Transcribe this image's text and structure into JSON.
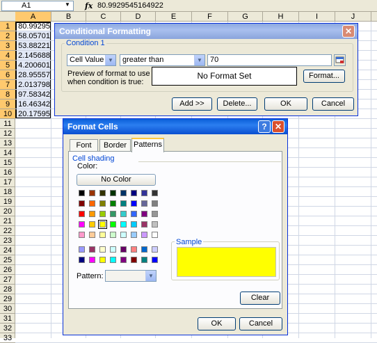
{
  "formula_bar": {
    "name_box": "A1",
    "fx_label": "fx",
    "value": "80.9929545164922"
  },
  "grid": {
    "columns": [
      "A",
      "B",
      "C",
      "D",
      "E",
      "F",
      "G",
      "H",
      "I",
      "J"
    ],
    "rows": [
      "1",
      "2",
      "3",
      "4",
      "5",
      "6",
      "7",
      "8",
      "9",
      "10",
      "11",
      "12",
      "13",
      "14",
      "15",
      "16",
      "17",
      "18",
      "19",
      "20",
      "21",
      "22",
      "23",
      "24",
      "25",
      "26",
      "27",
      "28",
      "29",
      "30",
      "31",
      "32",
      "33"
    ],
    "col_a_values": [
      "80.99295",
      "58.05701",
      "53.88221",
      "2.145688",
      "4.200601",
      "28.95557",
      "2.013798",
      "97.58342",
      "16.46342",
      "20.17595"
    ]
  },
  "conditional_formatting": {
    "title": "Conditional Formatting",
    "condition_label": "Condition 1",
    "type_value": "Cell Value Is",
    "operator_value": "greater than",
    "value": "70",
    "preview_label": "Preview of format to use when condition is true:",
    "preview_text": "No Format Set",
    "format_button": "Format...",
    "add_button": "Add >>",
    "delete_button": "Delete...",
    "ok_button": "OK",
    "cancel_button": "Cancel"
  },
  "format_cells": {
    "title": "Format Cells",
    "tabs": [
      "Font",
      "Border",
      "Patterns"
    ],
    "active_tab": "Patterns",
    "cell_shading_label": "Cell shading",
    "color_label": "Color:",
    "no_color_button": "No Color",
    "sample_label": "Sample",
    "sample_color": "#ffff00",
    "pattern_label": "Pattern:",
    "clear_button": "Clear",
    "ok_button": "OK",
    "cancel_button": "Cancel",
    "palette": [
      [
        "#000000",
        "#993300",
        "#333300",
        "#003300",
        "#003366",
        "#000080",
        "#333399",
        "#333333"
      ],
      [
        "#800000",
        "#ff6600",
        "#808000",
        "#008000",
        "#008080",
        "#0000ff",
        "#666699",
        "#808080"
      ],
      [
        "#ff0000",
        "#ff9900",
        "#99cc00",
        "#339966",
        "#33cccc",
        "#3366ff",
        "#800080",
        "#969696"
      ],
      [
        "#ff00ff",
        "#ffcc00",
        "#ffff00",
        "#00ff00",
        "#00ffff",
        "#00ccff",
        "#993366",
        "#c0c0c0"
      ],
      [
        "#ff99cc",
        "#ffcc99",
        "#ffff99",
        "#ccffcc",
        "#ccffff",
        "#99ccff",
        "#cc99ff",
        "#ffffff"
      ]
    ],
    "palette_extra": [
      [
        "#9999ff",
        "#993366",
        "#ffffcc",
        "#ccffff",
        "#660066",
        "#ff8080",
        "#0066cc",
        "#ccccff"
      ],
      [
        "#000080",
        "#ff00ff",
        "#ffff00",
        "#00ffff",
        "#800080",
        "#800000",
        "#008080",
        "#0000ff"
      ]
    ]
  }
}
